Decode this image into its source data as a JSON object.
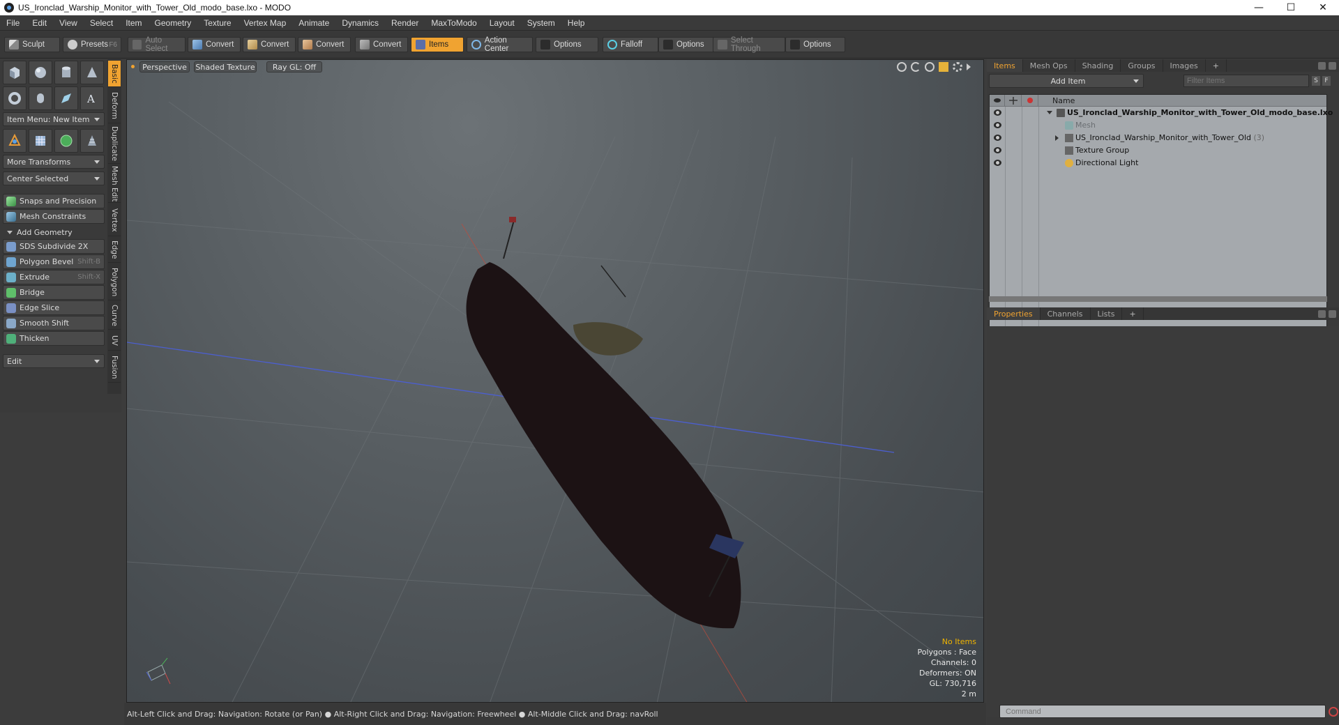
{
  "window": {
    "title": "US_Ironclad_Warship_Monitor_with_Tower_Old_modo_base.lxo - MODO",
    "minimize": "—",
    "maximize": "☐",
    "close": "✕"
  },
  "menu": [
    "File",
    "Edit",
    "View",
    "Select",
    "Item",
    "Geometry",
    "Texture",
    "Vertex Map",
    "Animate",
    "Dynamics",
    "Render",
    "MaxToModo",
    "Layout",
    "System",
    "Help"
  ],
  "toolbar": {
    "sculpt": "Sculpt",
    "presets": "Presets",
    "presets_shortcut": "F6",
    "auto_select": "Auto Select",
    "convert": "Convert",
    "items": "Items",
    "action_center": "Action Center",
    "options": "Options",
    "falloff": "Falloff",
    "select_through": "Select Through"
  },
  "left": {
    "item_menu": "Item Menu: New Item",
    "more_transforms": "More Transforms",
    "center_selected": "Center Selected",
    "snaps": "Snaps and Precision",
    "mesh_constraints": "Mesh Constraints",
    "add_geometry": "Add Geometry",
    "tools": [
      {
        "label": "SDS Subdivide 2X",
        "shortcut": ""
      },
      {
        "label": "Polygon Bevel",
        "shortcut": "Shift-B"
      },
      {
        "label": "Extrude",
        "shortcut": "Shift-X"
      },
      {
        "label": "Bridge",
        "shortcut": ""
      },
      {
        "label": "Edge Slice",
        "shortcut": ""
      },
      {
        "label": "Smooth Shift",
        "shortcut": ""
      },
      {
        "label": "Thicken",
        "shortcut": ""
      }
    ],
    "edit": "Edit",
    "vtabs": [
      "Basic",
      "Deform",
      "Duplicate",
      "Mesh Edit",
      "Vertex",
      "Edge",
      "Polygon",
      "Curve",
      "UV",
      "Fusion"
    ]
  },
  "viewport": {
    "view_mode": "Perspective",
    "shading": "Shaded Texture",
    "ray_gl": "Ray GL: Off",
    "info": {
      "no_items": "No Items",
      "polygons": "Polygons : Face",
      "channels": "Channels: 0",
      "deformers": "Deformers: ON",
      "gl": "GL: 730,716",
      "scale": "2 m"
    }
  },
  "items_panel": {
    "tabs": [
      "Items",
      "Mesh Ops",
      "Shading",
      "Groups",
      "Images",
      "+"
    ],
    "add_item": "Add Item",
    "filter_placeholder": "Filter Items",
    "s_btn": "S",
    "f_btn": "F",
    "name_col": "Name",
    "rows": [
      {
        "label": "US_Ironclad_Warship_Monitor_with_Tower_Old_modo_base.lxo",
        "count": ""
      },
      {
        "label": "Mesh",
        "count": ""
      },
      {
        "label": "US_Ironclad_Warship_Monitor_with_Tower_Old",
        "count": "(3)"
      },
      {
        "label": "Texture Group",
        "count": ""
      },
      {
        "label": "Directional Light",
        "count": ""
      }
    ]
  },
  "props_panel": {
    "tabs": [
      "Properties",
      "Channels",
      "Lists",
      "+"
    ]
  },
  "statusbar": {
    "text": "Alt-Left Click and Drag: Navigation: Rotate (or Pan) ● Alt-Right Click and Drag: Navigation: Freewheel ● Alt-Middle Click and Drag: navRoll"
  },
  "command": {
    "placeholder": "Command"
  },
  "colors": {
    "accent": "#f0a331",
    "ship_hull": "#1c1214",
    "grid": "#6e7478"
  }
}
